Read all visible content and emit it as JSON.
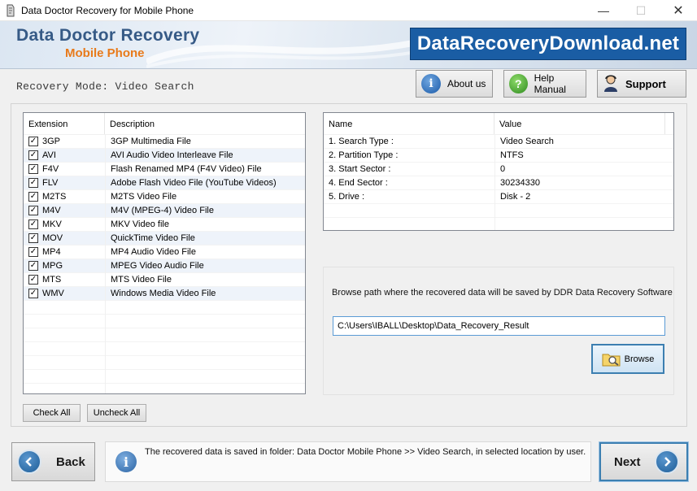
{
  "window": {
    "title": "Data Doctor Recovery for Mobile Phone",
    "minimize_glyph": "—",
    "maximize_glyph": "☐",
    "close_glyph": "✕"
  },
  "banner": {
    "brand_title": "Data Doctor Recovery",
    "brand_subtitle": "Mobile Phone",
    "site_logo": "DataRecoveryDownload.net"
  },
  "toolbar": {
    "mode_label": "Recovery Mode: Video Search",
    "about_label": "About us",
    "help_label": "Help Manual",
    "support_label": "Support"
  },
  "extensions": {
    "headers": [
      "Extension",
      "Description"
    ],
    "rows": [
      {
        "ext": "3GP",
        "desc": "3GP Multimedia File",
        "checked": true
      },
      {
        "ext": "AVI",
        "desc": "AVI Audio Video Interleave File",
        "checked": true
      },
      {
        "ext": "F4V",
        "desc": "Flash Renamed MP4 (F4V Video) File",
        "checked": true
      },
      {
        "ext": "FLV",
        "desc": "Adobe Flash Video File (YouTube Videos)",
        "checked": true
      },
      {
        "ext": "M2TS",
        "desc": "M2TS Video File",
        "checked": true
      },
      {
        "ext": "M4V",
        "desc": "M4V (MPEG-4) Video File",
        "checked": true
      },
      {
        "ext": "MKV",
        "desc": "MKV Video file",
        "checked": true
      },
      {
        "ext": "MOV",
        "desc": "QuickTime Video File",
        "checked": true
      },
      {
        "ext": "MP4",
        "desc": "MP4 Audio Video File",
        "checked": true
      },
      {
        "ext": "MPG",
        "desc": "MPEG Video Audio File",
        "checked": true
      },
      {
        "ext": "MTS",
        "desc": "MTS Video File",
        "checked": true
      },
      {
        "ext": "WMV",
        "desc": "Windows Media Video File",
        "checked": true
      }
    ],
    "check_all_label": "Check All",
    "uncheck_all_label": "Uncheck All"
  },
  "info": {
    "headers": [
      "Name",
      "Value"
    ],
    "rows": [
      {
        "name": "1. Search Type :",
        "value": "Video Search"
      },
      {
        "name": "2. Partition Type :",
        "value": "NTFS"
      },
      {
        "name": "3. Start Sector :",
        "value": "0"
      },
      {
        "name": "4. End Sector :",
        "value": "30234330"
      },
      {
        "name": "5. Drive :",
        "value": "Disk - 2"
      }
    ]
  },
  "browse": {
    "prompt": "Browse path where the recovered data will be saved by DDR Data Recovery Software",
    "path_value": "C:\\Users\\IBALL\\Desktop\\Data_Recovery_Result",
    "button_label": "Browse"
  },
  "footer": {
    "back_label": "Back",
    "next_label": "Next",
    "status_text": "The recovered data is saved in folder: Data Doctor Mobile Phone  >> Video Search, in selected location by user."
  },
  "icons": {
    "about": "info-icon",
    "help": "help-icon",
    "support": "support-person-icon",
    "browse": "folder-search-icon",
    "back": "arrow-left-icon",
    "next": "arrow-right-icon",
    "status": "info-icon"
  },
  "colors": {
    "brand_title": "#365a86",
    "brand_subtitle": "#e87a1a",
    "site_logo_bg": "#1a5da4",
    "row_alt": "#eef3fa",
    "focus_border": "#3c7fb1"
  }
}
